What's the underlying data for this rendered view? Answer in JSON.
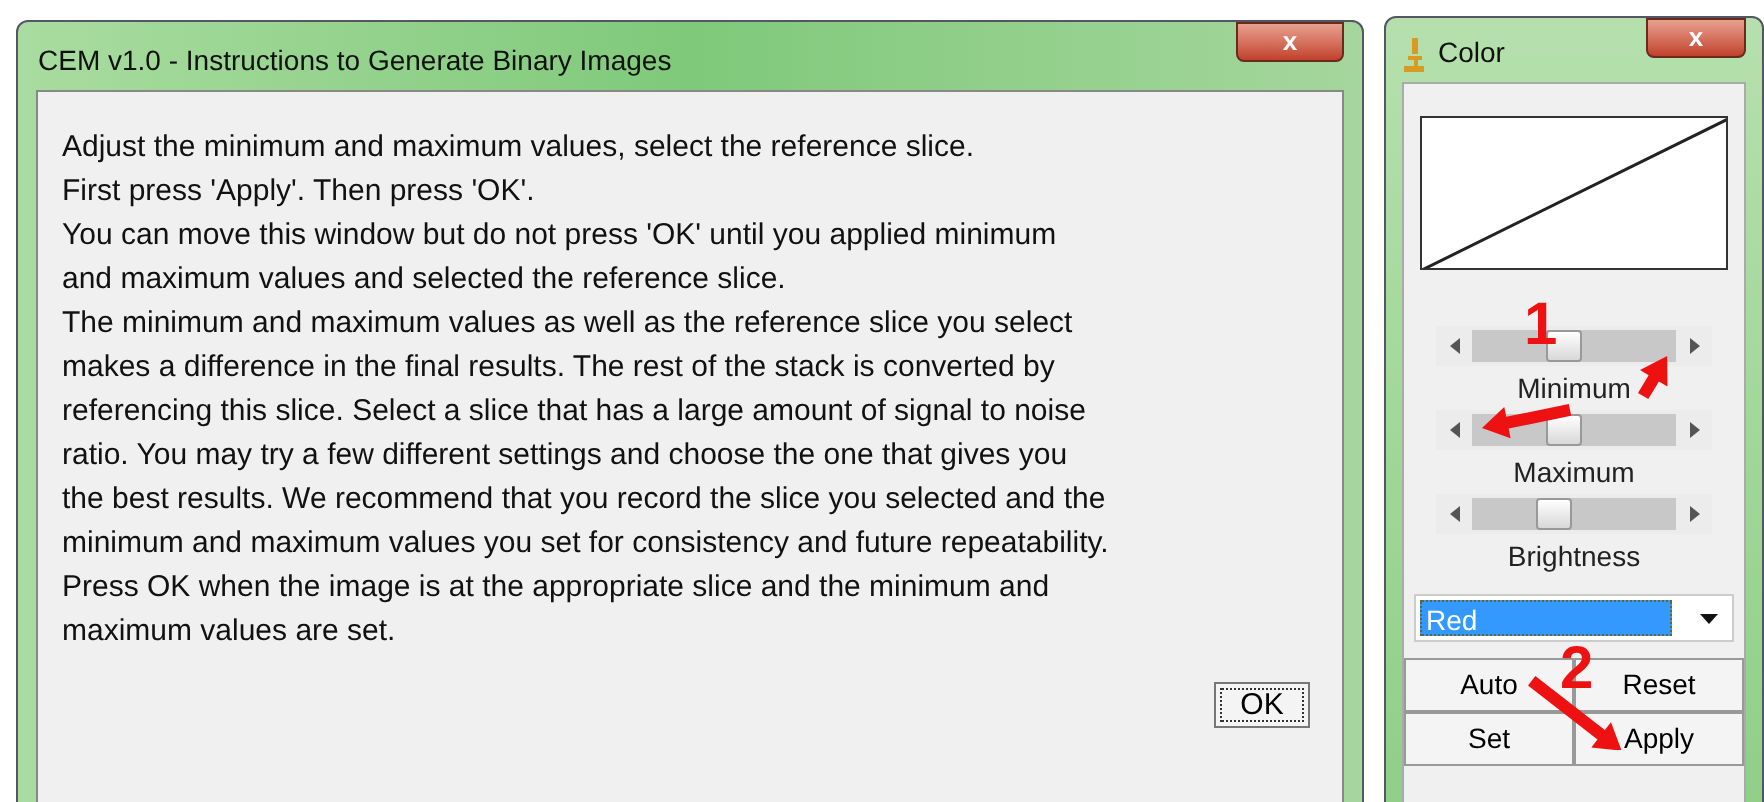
{
  "instructions_window": {
    "title": "CEM v1.0 - Instructions to Generate Binary Images",
    "close": "x",
    "lines": [
      "Adjust the minimum and maximum values, select the reference slice.",
      "First press 'Apply'. Then press 'OK'.",
      "You can move this window but do not press 'OK' until you applied minimum",
      "and maximum values and selected the reference slice.",
      "The minimum and maximum values as well as the reference slice you select",
      "makes a difference in the final results. The rest of the stack is converted by",
      "referencing this slice. Select a slice that has a large amount of signal to noise",
      "ratio. You may try a few different settings and choose the one that gives you",
      "the best results. We recommend that you record the slice you selected and the",
      "minimum and maximum values you set for consistency and future repeatability.",
      "Press OK when the image is at the appropriate slice and the minimum and",
      "maximum values are set."
    ],
    "ok_button": "OK"
  },
  "color_window": {
    "title": "Color",
    "close": "x",
    "sliders": [
      {
        "label": "Minimum",
        "level": 0.45
      },
      {
        "label": "Maximum",
        "level": 0.45
      },
      {
        "label": "Brightness",
        "level": 0.4
      }
    ],
    "channel": {
      "value": "Red"
    },
    "buttons": [
      "Auto",
      "Reset",
      "Set",
      "Apply"
    ]
  },
  "annotations": [
    {
      "label": "1"
    },
    {
      "label": "2"
    }
  ]
}
